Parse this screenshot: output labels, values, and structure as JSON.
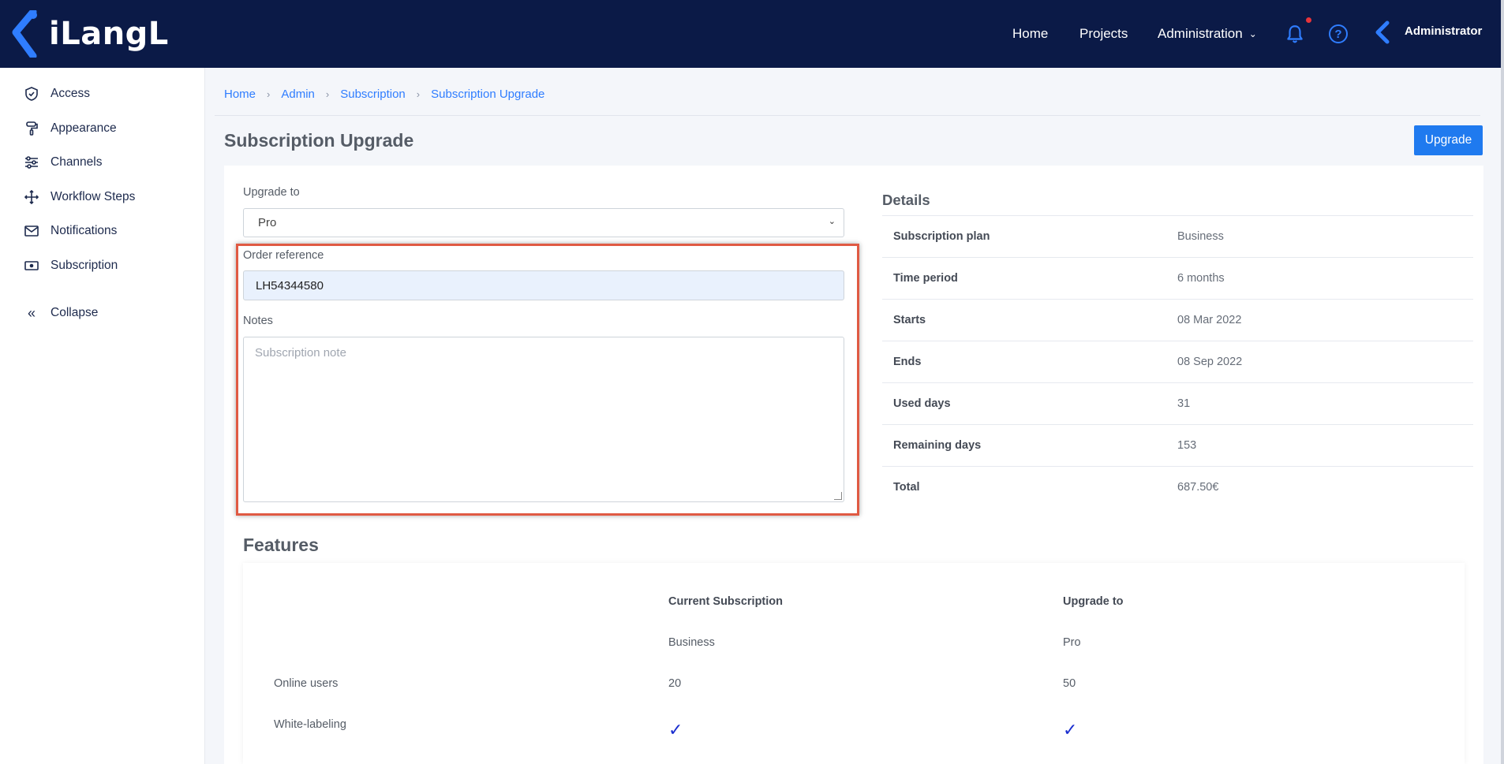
{
  "topbar": {
    "logo_text": "iLangL",
    "nav": [
      "Home",
      "Projects",
      "Administration"
    ],
    "user_name": "Administrator"
  },
  "sidebar": {
    "items": [
      {
        "label": "Access",
        "icon": "shield-check-icon"
      },
      {
        "label": "Appearance",
        "icon": "paint-roller-icon"
      },
      {
        "label": "Channels",
        "icon": "sliders-icon"
      },
      {
        "label": "Workflow Steps",
        "icon": "move-arrows-icon"
      },
      {
        "label": "Notifications",
        "icon": "envelope-icon"
      },
      {
        "label": "Subscription",
        "icon": "money-icon"
      }
    ],
    "collapse_label": "Collapse"
  },
  "breadcrumb": [
    "Home",
    "Admin",
    "Subscription",
    "Subscription Upgrade"
  ],
  "page": {
    "title": "Subscription Upgrade",
    "upgrade_button": "Upgrade"
  },
  "form": {
    "upgrade_to_label": "Upgrade to",
    "upgrade_to_value": "Pro",
    "order_reference_label": "Order reference",
    "order_reference_value": "LH54344580",
    "notes_label": "Notes",
    "notes_placeholder": "Subscription note"
  },
  "details": {
    "title": "Details",
    "rows": [
      {
        "key": "Subscription plan",
        "value": "Business"
      },
      {
        "key": "Time period",
        "value": "6 months"
      },
      {
        "key": "Starts",
        "value": "08 Mar 2022"
      },
      {
        "key": "Ends",
        "value": "08 Sep 2022"
      },
      {
        "key": "Used days",
        "value": "31"
      },
      {
        "key": "Remaining days",
        "value": "153"
      },
      {
        "key": "Total",
        "value": "687.50€"
      }
    ]
  },
  "features": {
    "title": "Features",
    "col_current": "Current Subscription",
    "col_upgrade": "Upgrade to",
    "current_plan": "Business",
    "upgrade_plan": "Pro",
    "rows": [
      {
        "label": "Online users",
        "current": "20",
        "upgrade": "50"
      },
      {
        "label": "White-labeling",
        "current": "✓",
        "upgrade": "✓"
      }
    ]
  }
}
